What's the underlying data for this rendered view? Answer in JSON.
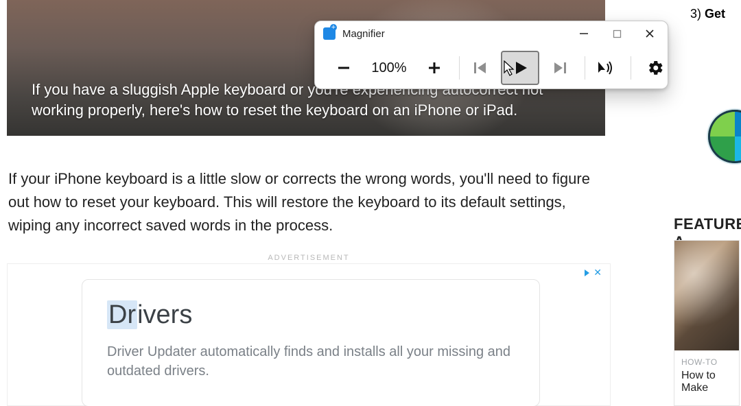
{
  "hero": {
    "blurb": "If you have a sluggish Apple keyboard or you're experiencing autocorrect not working properly, here's how to reset the keyboard on an iPhone or iPad."
  },
  "article": {
    "paragraph": "If your iPhone keyboard is a little slow or corrects the wrong words, you'll need to figure out how to reset your keyboard. This will restore the keyboard to its default settings, wiping any incorrect saved words in the process."
  },
  "advert": {
    "label": "ADVERTISEMENT",
    "title_highlight": "Dr",
    "title_rest": "ivers",
    "description": "Driver Updater automatically finds and installs all your missing and outdated drivers.",
    "close_glyph": "✕"
  },
  "sidebar": {
    "step3_prefix": "3)  ",
    "step3_bold": "Get",
    "heading": "FEATURED A",
    "card": {
      "category": "HOW-TO",
      "title": "How to Make"
    }
  },
  "magnifier": {
    "title": "Magnifier",
    "zoom_level": "100%",
    "icons": {
      "zoom_out": "minus",
      "zoom_in": "plus",
      "prev": "previous",
      "play": "play",
      "next": "next",
      "cursor_sound": "cursor-speaker",
      "settings": "gear"
    }
  }
}
